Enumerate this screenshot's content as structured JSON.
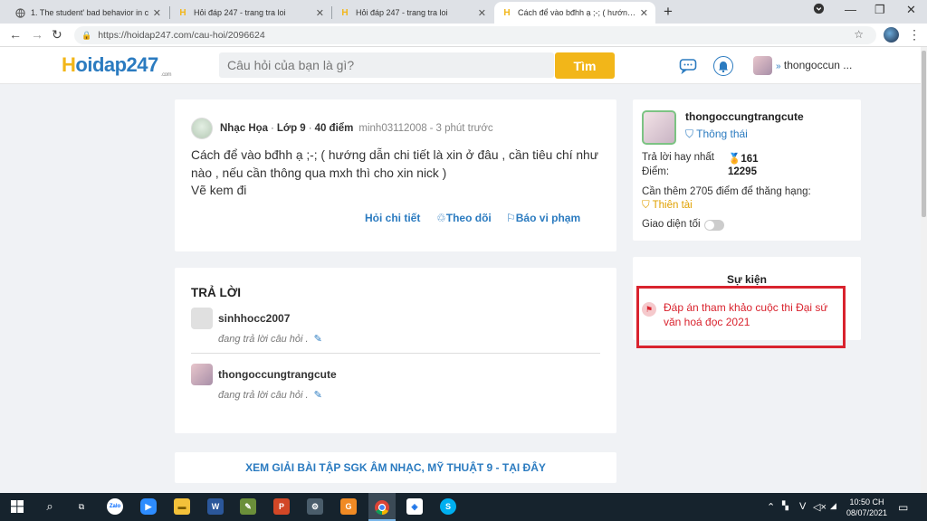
{
  "browser": {
    "tabs": [
      {
        "title": "1. The student' bad behavior in c",
        "icon": "globe-icon"
      },
      {
        "title": "Hỏi đáp 247 - trang tra loi",
        "icon": "hoidap-icon"
      },
      {
        "title": "Hỏi đáp 247 - trang tra loi",
        "icon": "hoidap-icon"
      },
      {
        "title": "Cách để vào bđhh ạ ;-; ( hướng d",
        "icon": "hoidap-icon"
      }
    ],
    "url": "https://hoidap247.com/cau-hoi/2096624"
  },
  "site": {
    "logo": "Hoidap247",
    "logo_h": "H",
    "logo_rest": "oidap247",
    "logo_sub": ".com",
    "search_placeholder": "Câu hỏi của bạn là gì?",
    "search_button": "Tìm",
    "header_user": "thongoccun ..."
  },
  "question": {
    "subject": "Nhạc Họa",
    "grade": "Lớp 9",
    "points": "40 điểm",
    "author": "minh03112008",
    "time": "3 phút trước",
    "line1": "Cách để vào bđhh ạ ;-; ( hướng dẫn chi tiết là xin ở đâu , cần tiêu chí như",
    "line2": "nào , nếu cần thông qua mxh thì cho xin nick )",
    "line3": "Vẽ kem đi",
    "actions": {
      "detail": "Hỏi chi tiết",
      "follow": "Theo dõi",
      "report": "Báo vi phạm"
    }
  },
  "answers": {
    "title": "TRẢ LỜI",
    "items": [
      {
        "user": "sinhhocc2007",
        "status": "đang trả lời câu hỏi ."
      },
      {
        "user": "thongoccungtrangcute",
        "status": "đang trả lời câu hỏi ."
      }
    ]
  },
  "banner": {
    "text": "XEM GIẢI BÀI TẬP SGK ÂM NHẠC, MỸ THUẬT 9 - TẠI ĐÂY"
  },
  "profile": {
    "name": "thongoccungtrangcute",
    "status": "Thông thái",
    "best_label": "Trả lời hay nhất",
    "best_value": "161",
    "points_label": "Điểm:",
    "points_value": "12295",
    "need_text": "Cần thêm 2705 điểm để thăng hạng:",
    "next_rank": "Thiên tài",
    "dark_mode_label": "Giao diện tối",
    "dark_mode_on": false
  },
  "events": {
    "title": "Sự kiện",
    "item_line1": "Đáp án tham khảo cuộc thi Đại sứ",
    "item_line2": "văn hoá đọc 2021"
  },
  "taskbar": {
    "clock_time": "10:50 CH",
    "clock_date": "08/07/2021",
    "lang": "V"
  },
  "colors": {
    "brand_blue": "#2b7bc0",
    "brand_yellow": "#f2b619",
    "highlight_red": "#d9232e"
  }
}
